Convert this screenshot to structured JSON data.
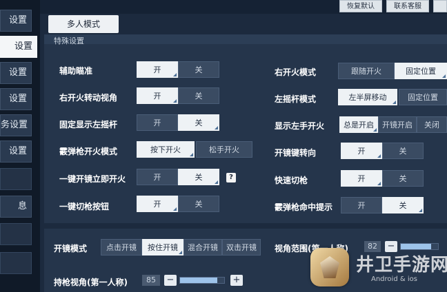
{
  "sidebar": {
    "items": [
      {
        "label": "设置",
        "active": false
      },
      {
        "label": "设置",
        "active": true
      },
      {
        "label": "设置",
        "active": false
      },
      {
        "label": "设置",
        "active": false
      },
      {
        "label": "务设置",
        "active": false
      },
      {
        "label": "设置",
        "active": false
      },
      {
        "label": "息",
        "active": false
      }
    ]
  },
  "top_buttons": {
    "restore_default": "恢复默认",
    "contact_support": "联系客服"
  },
  "mode_tab": "多人模式",
  "panel_title": "特殊设置",
  "settings": {
    "aim_assist": {
      "label": "辅助瞄准",
      "options": [
        "开",
        "关"
      ],
      "selected": 0
    },
    "right_fire_turn_view": {
      "label": "右开火转动视角",
      "options": [
        "开",
        "关"
      ],
      "selected": 0
    },
    "fixed_show_left_joystick": {
      "label": "固定显示左摇杆",
      "options": [
        "开",
        "关"
      ],
      "selected": 1
    },
    "shotgun_fire_mode": {
      "label": "霰弹枪开火模式",
      "options": [
        "按下开火",
        "松手开火"
      ],
      "selected": 0
    },
    "scope_instant_fire": {
      "label": "一键开镜立即开火",
      "options": [
        "开",
        "关"
      ],
      "selected": 1
    },
    "quick_switch_button": {
      "label": "一键切枪按钮",
      "options": [
        "开",
        "关"
      ],
      "selected": 0
    },
    "right_fire_mode": {
      "label": "右开火模式",
      "options": [
        "跟随开火",
        "固定位置"
      ],
      "selected": 1
    },
    "left_joystick_mode": {
      "label": "左摇杆模式",
      "options": [
        "左半屏移动",
        "固定位置"
      ],
      "selected": 0
    },
    "show_left_fire": {
      "label": "显示左手开火",
      "options": [
        "总是开启",
        "开镜开启",
        "关闭"
      ],
      "selected": 0
    },
    "fire_key_turn": {
      "label": "开镜键转向",
      "options": [
        "开",
        "关"
      ],
      "selected": 0
    },
    "quick_switch_gun": {
      "label": "快速切枪",
      "options": [
        "开",
        "关"
      ],
      "selected": 0
    },
    "shotgun_hit_hint": {
      "label": "霰弹枪命中提示",
      "options": [
        "开",
        "关"
      ],
      "selected": 1
    }
  },
  "scope_mode": {
    "label": "开镜模式",
    "options": [
      "点击开镜",
      "按住开镜",
      "混合开镜",
      "双击开镜"
    ],
    "selected": 1
  },
  "view_range": {
    "label": "视角范围(第一人称)",
    "value": "82",
    "level": 0.82
  },
  "gun_view": {
    "label": "持枪视角(第一人称)",
    "value": "85",
    "level": 0.85,
    "minus": "−",
    "plus": "+"
  },
  "watermark": {
    "title": "井卫手游网",
    "subtitle": "Android & ios"
  }
}
